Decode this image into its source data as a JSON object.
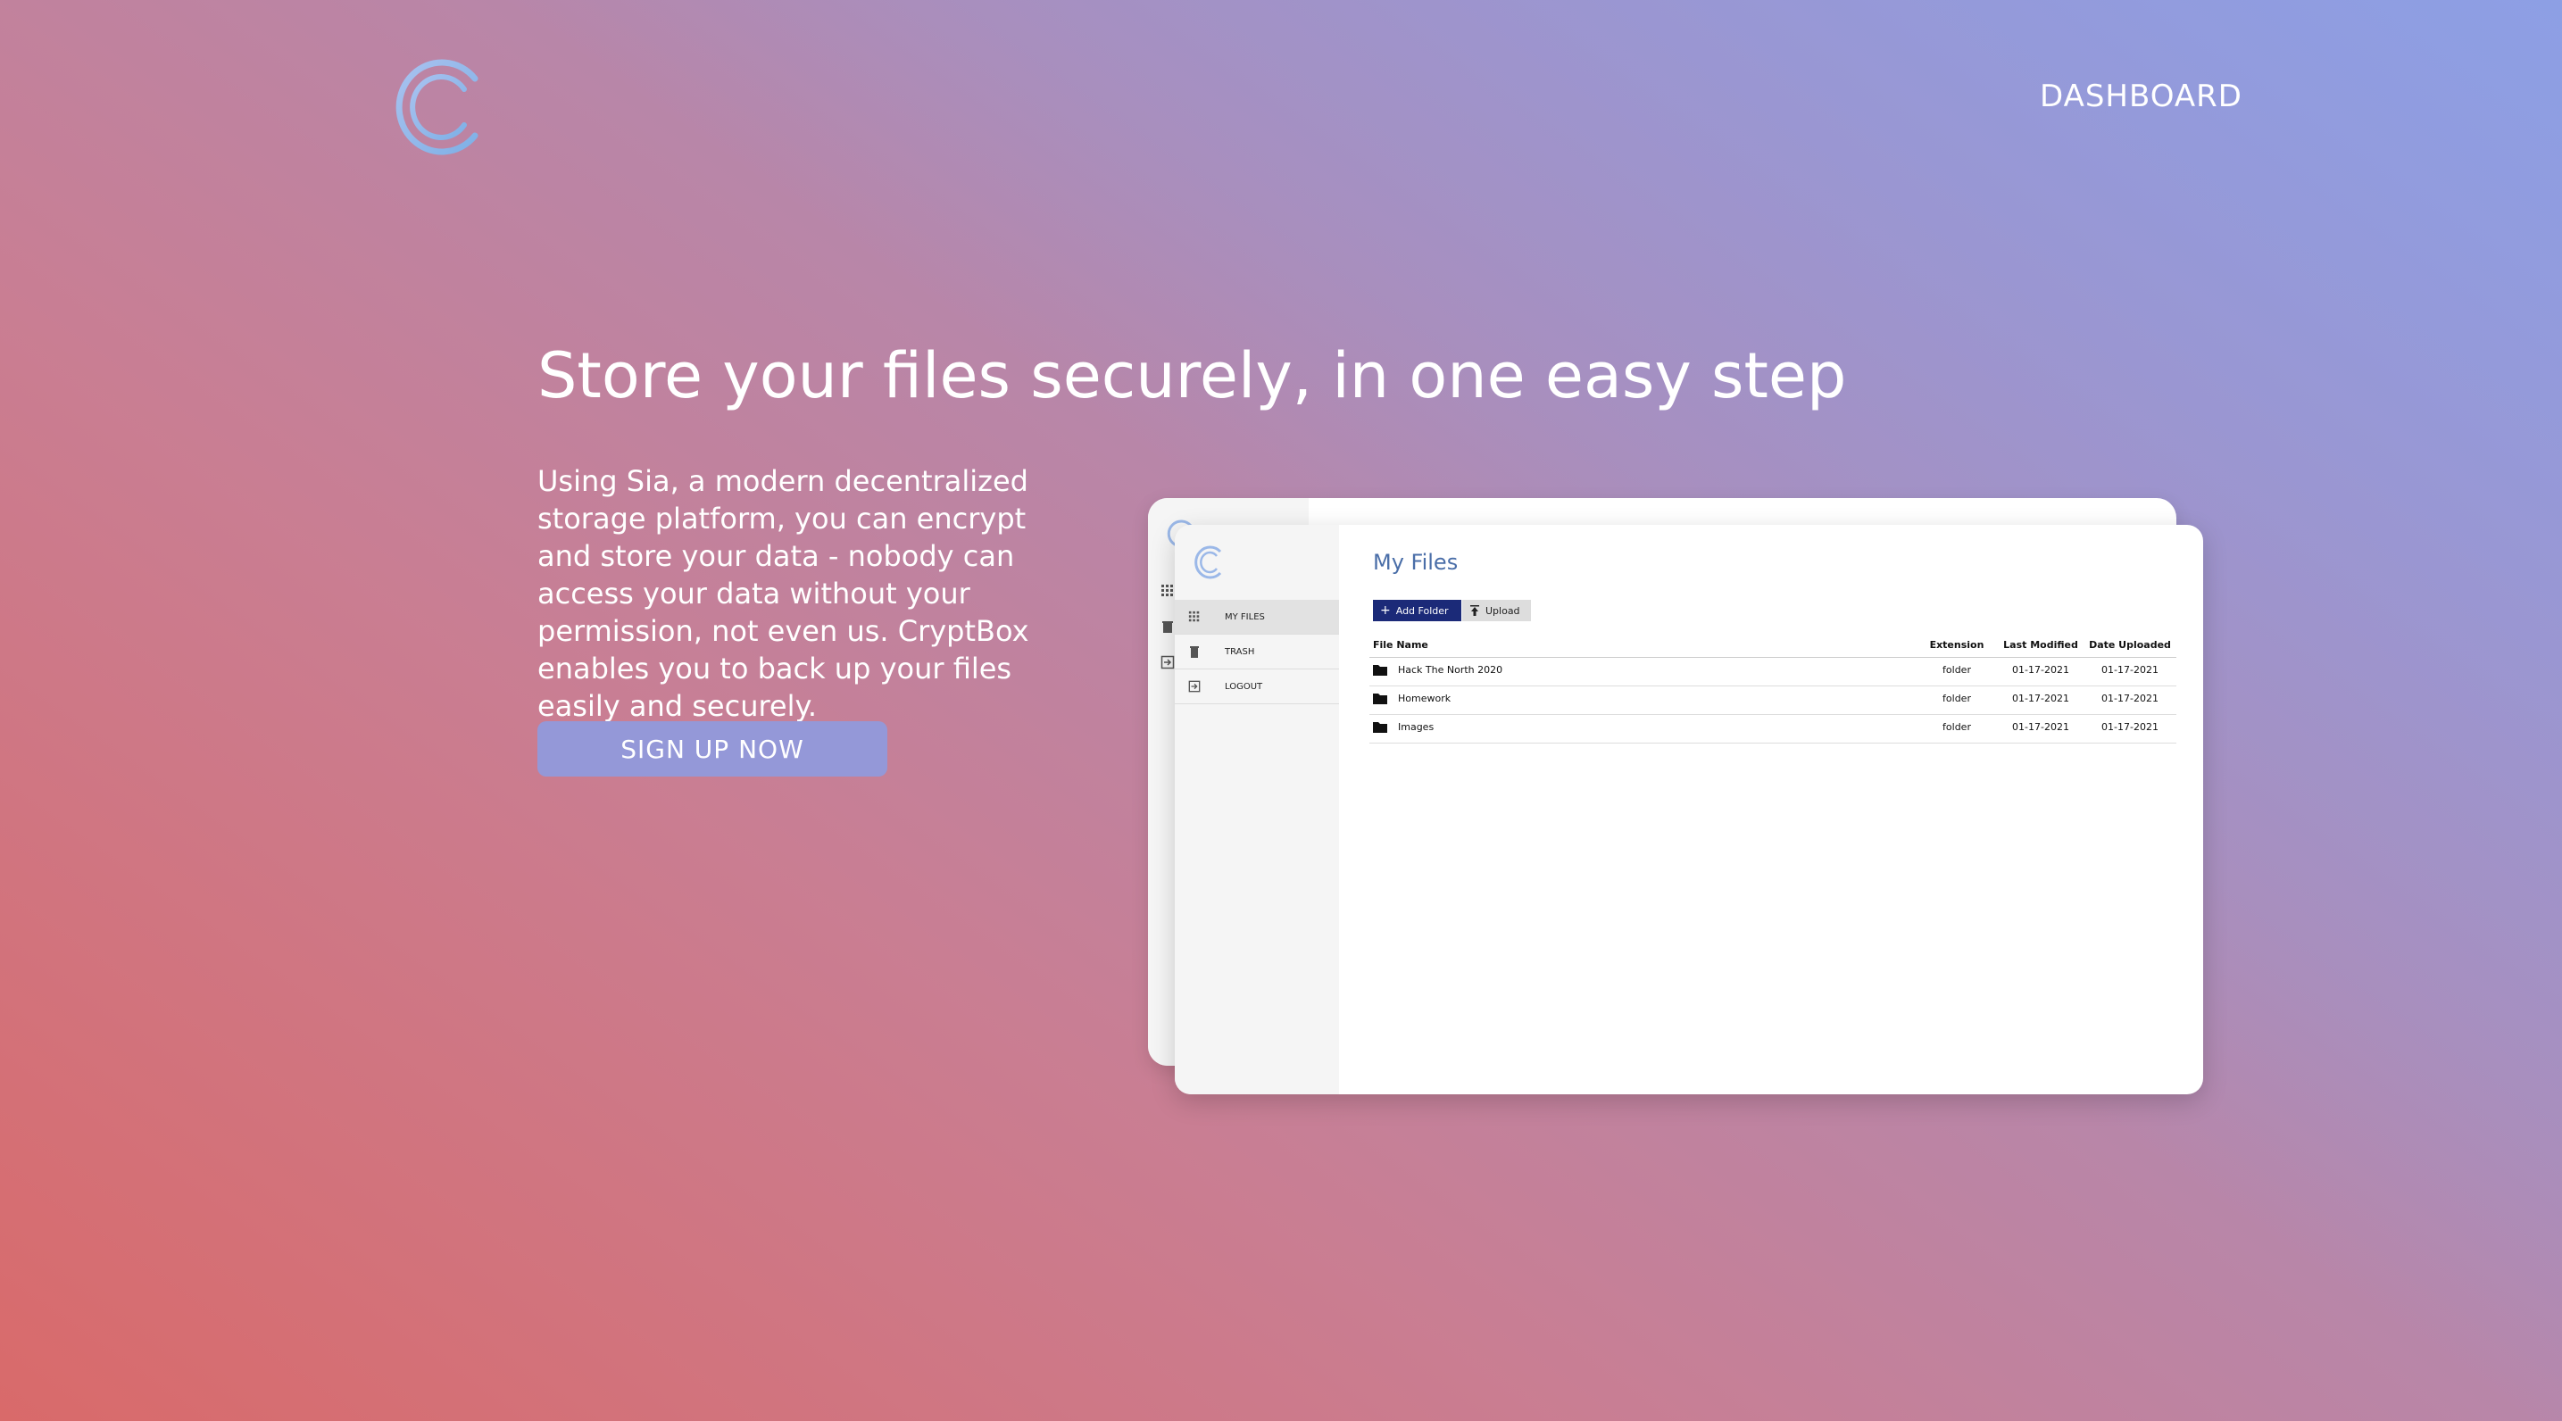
{
  "nav": {
    "dashboard": "DASHBOARD"
  },
  "hero": {
    "title": "Store your files securely, in one easy step",
    "description": "Using Sia, a modern decentralized storage platform, you can encrypt and store your data - nobody can access your data without your permission, not even us. CryptBox enables you to back up your files easily and securely.",
    "cta": "SIGN UP NOW"
  },
  "preview": {
    "sidebar": [
      {
        "label": "MY FILES",
        "icon": "grid-icon"
      },
      {
        "label": "TRASH",
        "icon": "trash-icon"
      },
      {
        "label": "LOGOUT",
        "icon": "logout-icon"
      }
    ],
    "title": "My Files",
    "add_folder": "Add Folder",
    "upload": "Upload",
    "columns": {
      "name": "File Name",
      "ext": "Extension",
      "modified": "Last Modified",
      "uploaded": "Date Uploaded"
    },
    "rows": [
      {
        "name": "Hack The North 2020",
        "ext": "folder",
        "modified": "01-17-2021",
        "uploaded": "01-17-2021"
      },
      {
        "name": "Homework",
        "ext": "folder",
        "modified": "01-17-2021",
        "uploaded": "01-17-2021"
      },
      {
        "name": "Images",
        "ext": "folder",
        "modified": "01-17-2021",
        "uploaded": "01-17-2021"
      }
    ]
  },
  "colors": {
    "accent": "#9498d8",
    "title_blue": "#4a6ea8",
    "add_button": "#1b2a78"
  }
}
